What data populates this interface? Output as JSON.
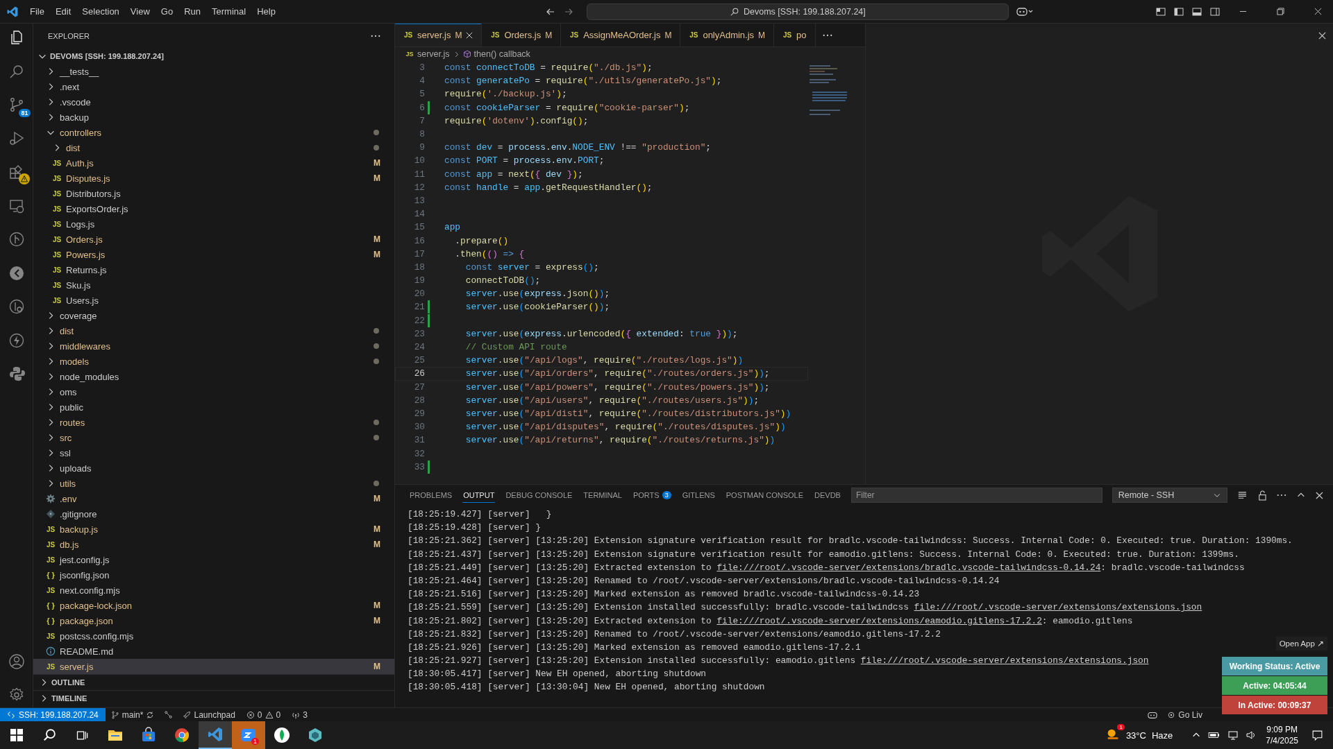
{
  "menu": [
    "File",
    "Edit",
    "Selection",
    "View",
    "Go",
    "Run",
    "Terminal",
    "Help"
  ],
  "command_center": "Devoms [SSH: 199.188.207.24]",
  "activity_bar": {
    "source_control_badge": "81"
  },
  "sidebar": {
    "title": "EXPLORER",
    "root": "DEVOMS [SSH: 199.188.207.24]",
    "root_expanded": true,
    "items": [
      {
        "name": "__tests__",
        "kind": "folder",
        "expanded": false,
        "dot": false,
        "selected": false
      },
      {
        "name": ".next",
        "kind": "folder",
        "expanded": false,
        "dot": false,
        "selected": false
      },
      {
        "name": ".vscode",
        "kind": "folder",
        "expanded": false,
        "dot": false,
        "selected": false
      },
      {
        "name": "backup",
        "kind": "folder",
        "expanded": false,
        "dot": false,
        "selected": false
      },
      {
        "name": "controllers",
        "kind": "folder",
        "expanded": true,
        "dot": true,
        "selected": false,
        "children": [
          {
            "name": "dist",
            "kind": "folder",
            "expanded": false,
            "dot": true,
            "selected": false
          },
          {
            "name": "Auth.js",
            "kind": "js",
            "icon": "JS",
            "badge": "M",
            "dot": false,
            "selected": false
          },
          {
            "name": "Disputes.js",
            "kind": "js",
            "icon": "JS",
            "badge": "M",
            "dot": false,
            "selected": false
          },
          {
            "name": "Distributors.js",
            "kind": "js",
            "icon": "JS",
            "dot": false,
            "selected": false
          },
          {
            "name": "ExportsOrder.js",
            "kind": "js",
            "icon": "JS",
            "dot": false,
            "selected": false
          },
          {
            "name": "Logs.js",
            "kind": "js",
            "icon": "JS",
            "dot": false,
            "selected": false
          },
          {
            "name": "Orders.js",
            "kind": "js",
            "icon": "JS",
            "badge": "M",
            "dot": false,
            "selected": false
          },
          {
            "name": "Powers.js",
            "kind": "js",
            "icon": "JS",
            "badge": "M",
            "dot": false,
            "selected": false
          },
          {
            "name": "Returns.js",
            "kind": "js",
            "icon": "JS",
            "dot": false,
            "selected": false
          },
          {
            "name": "Sku.js",
            "kind": "js",
            "icon": "JS",
            "dot": false,
            "selected": false
          },
          {
            "name": "Users.js",
            "kind": "js",
            "icon": "JS",
            "dot": false,
            "selected": false
          }
        ]
      },
      {
        "name": "coverage",
        "kind": "folder",
        "expanded": false,
        "dot": false,
        "selected": false
      },
      {
        "name": "dist",
        "kind": "folder",
        "expanded": false,
        "dot": true,
        "selected": false
      },
      {
        "name": "middlewares",
        "kind": "folder",
        "expanded": false,
        "dot": true,
        "selected": false
      },
      {
        "name": "models",
        "kind": "folder",
        "expanded": false,
        "dot": true,
        "selected": false
      },
      {
        "name": "node_modules",
        "kind": "folder",
        "expanded": false,
        "dot": false,
        "selected": false
      },
      {
        "name": "oms",
        "kind": "folder",
        "expanded": false,
        "dot": false,
        "selected": false
      },
      {
        "name": "public",
        "kind": "folder",
        "expanded": false,
        "dot": false,
        "selected": false
      },
      {
        "name": "routes",
        "kind": "folder",
        "expanded": false,
        "dot": true,
        "selected": false
      },
      {
        "name": "src",
        "kind": "folder",
        "expanded": false,
        "dot": true,
        "selected": false
      },
      {
        "name": "ssl",
        "kind": "folder",
        "expanded": false,
        "dot": false,
        "selected": false
      },
      {
        "name": "uploads",
        "kind": "folder",
        "expanded": false,
        "dot": false,
        "selected": false
      },
      {
        "name": "utils",
        "kind": "folder",
        "expanded": false,
        "dot": true,
        "selected": false
      },
      {
        "name": ".env",
        "kind": "env",
        "badge": "M",
        "dot": false,
        "selected": false
      },
      {
        "name": ".gitignore",
        "kind": "git",
        "dot": false,
        "selected": false
      },
      {
        "name": "backup.js",
        "kind": "js",
        "icon": "JS",
        "badge": "M",
        "dot": false,
        "selected": false
      },
      {
        "name": "db.js",
        "kind": "js",
        "icon": "JS",
        "badge": "M",
        "dot": false,
        "selected": false
      },
      {
        "name": "jest.config.js",
        "kind": "js",
        "icon": "JS",
        "dot": false,
        "selected": false
      },
      {
        "name": "jsconfig.json",
        "kind": "json",
        "icon": "{ }",
        "dot": false,
        "selected": false
      },
      {
        "name": "next.config.mjs",
        "kind": "js",
        "icon": "JS",
        "dot": false,
        "selected": false
      },
      {
        "name": "package-lock.json",
        "kind": "json",
        "icon": "{ }",
        "badge": "M",
        "dot": false,
        "selected": false
      },
      {
        "name": "package.json",
        "kind": "json",
        "icon": "{ }",
        "badge": "M",
        "dot": false,
        "selected": false
      },
      {
        "name": "postcss.config.mjs",
        "kind": "js",
        "icon": "JS",
        "dot": false,
        "selected": false
      },
      {
        "name": "README.md",
        "kind": "info",
        "dot": false,
        "selected": false
      },
      {
        "name": "server.js",
        "kind": "js",
        "icon": "JS",
        "badge": "M",
        "dot": false,
        "selected": true
      }
    ],
    "sections": [
      {
        "label": "OUTLINE",
        "expanded": false
      },
      {
        "label": "TIMELINE",
        "expanded": false
      }
    ]
  },
  "tabs": [
    {
      "icon": "JS",
      "label": "server.js",
      "badge": "M",
      "selected": true
    },
    {
      "icon": "JS",
      "label": "Orders.js",
      "badge": "M",
      "selected": false
    },
    {
      "icon": "JS",
      "label": "AssignMeAOrder.js",
      "badge": "M",
      "selected": false
    },
    {
      "icon": "JS",
      "label": "onlyAdmin.js",
      "badge": "M",
      "selected": false
    },
    {
      "icon": "JS",
      "label": "po",
      "selected": false
    }
  ],
  "breadcrumb": [
    {
      "icon": "JS",
      "label": "server.js"
    },
    {
      "label": "then() callback"
    }
  ],
  "code": {
    "lines": [
      {
        "n": "3",
        "current": false,
        "changed": false,
        "tokens": [
          {
            "kind": "k",
            "text": "const "
          },
          {
            "kind": "n",
            "text": "connectToDB"
          },
          {
            "kind": "p",
            "text": " = "
          },
          {
            "kind": "f",
            "text": "require"
          },
          {
            "kind": "b1",
            "text": "("
          },
          {
            "kind": "s",
            "text": "\"./db.js\""
          },
          {
            "kind": "b1",
            "text": ")"
          },
          {
            "kind": "p",
            "text": ";"
          }
        ]
      },
      {
        "n": "4",
        "current": false,
        "changed": false,
        "tokens": [
          {
            "kind": "k",
            "text": "const "
          },
          {
            "kind": "n",
            "text": "generatePo"
          },
          {
            "kind": "p",
            "text": " = "
          },
          {
            "kind": "f",
            "text": "require"
          },
          {
            "kind": "b1",
            "text": "("
          },
          {
            "kind": "s",
            "text": "\"./utils/generatePo.js\""
          },
          {
            "kind": "b1",
            "text": ")"
          },
          {
            "kind": "p",
            "text": ";"
          }
        ]
      },
      {
        "n": "5",
        "current": false,
        "changed": false,
        "tokens": [
          {
            "kind": "f",
            "text": "require"
          },
          {
            "kind": "b1",
            "text": "("
          },
          {
            "kind": "s",
            "text": "'./backup.js'"
          },
          {
            "kind": "b1",
            "text": ")"
          },
          {
            "kind": "p",
            "text": ";"
          }
        ]
      },
      {
        "n": "6",
        "current": false,
        "changed": true,
        "tokens": [
          {
            "kind": "k",
            "text": "const "
          },
          {
            "kind": "n",
            "text": "cookieParser"
          },
          {
            "kind": "p",
            "text": " = "
          },
          {
            "kind": "f",
            "text": "require"
          },
          {
            "kind": "b1",
            "text": "("
          },
          {
            "kind": "s",
            "text": "\"cookie-parser\""
          },
          {
            "kind": "b1",
            "text": ")"
          },
          {
            "kind": "p",
            "text": ";"
          }
        ]
      },
      {
        "n": "7",
        "current": false,
        "changed": false,
        "tokens": [
          {
            "kind": "f",
            "text": "require"
          },
          {
            "kind": "b1",
            "text": "("
          },
          {
            "kind": "s",
            "text": "'dotenv'"
          },
          {
            "kind": "b1",
            "text": ")"
          },
          {
            "kind": "p",
            "text": "."
          },
          {
            "kind": "f",
            "text": "config"
          },
          {
            "kind": "b1",
            "text": "()"
          },
          {
            "kind": "p",
            "text": ";"
          }
        ]
      },
      {
        "n": "8",
        "current": false,
        "changed": false
      },
      {
        "n": "9",
        "current": false,
        "changed": false,
        "tokens": [
          {
            "kind": "k",
            "text": "const "
          },
          {
            "kind": "n",
            "text": "dev"
          },
          {
            "kind": "p",
            "text": " = "
          },
          {
            "kind": "v",
            "text": "process"
          },
          {
            "kind": "p",
            "text": "."
          },
          {
            "kind": "v",
            "text": "env"
          },
          {
            "kind": "p",
            "text": "."
          },
          {
            "kind": "n",
            "text": "NODE_ENV"
          },
          {
            "kind": "p",
            "text": " !== "
          },
          {
            "kind": "s",
            "text": "\"production\""
          },
          {
            "kind": "p",
            "text": ";"
          }
        ]
      },
      {
        "n": "10",
        "current": false,
        "changed": false,
        "tokens": [
          {
            "kind": "k",
            "text": "const "
          },
          {
            "kind": "n",
            "text": "PORT"
          },
          {
            "kind": "p",
            "text": " = "
          },
          {
            "kind": "v",
            "text": "process"
          },
          {
            "kind": "p",
            "text": "."
          },
          {
            "kind": "v",
            "text": "env"
          },
          {
            "kind": "p",
            "text": "."
          },
          {
            "kind": "n",
            "text": "PORT"
          },
          {
            "kind": "p",
            "text": ";"
          }
        ]
      },
      {
        "n": "11",
        "current": false,
        "changed": false,
        "tokens": [
          {
            "kind": "k",
            "text": "const "
          },
          {
            "kind": "n",
            "text": "app"
          },
          {
            "kind": "p",
            "text": " = "
          },
          {
            "kind": "f",
            "text": "next"
          },
          {
            "kind": "b1",
            "text": "("
          },
          {
            "kind": "b2",
            "text": "{"
          },
          {
            "kind": "v",
            "text": " dev "
          },
          {
            "kind": "b2",
            "text": "}"
          },
          {
            "kind": "b1",
            "text": ")"
          },
          {
            "kind": "p",
            "text": ";"
          }
        ]
      },
      {
        "n": "12",
        "current": false,
        "changed": false,
        "tokens": [
          {
            "kind": "k",
            "text": "const "
          },
          {
            "kind": "n",
            "text": "handle"
          },
          {
            "kind": "p",
            "text": " = "
          },
          {
            "kind": "n",
            "text": "app"
          },
          {
            "kind": "p",
            "text": "."
          },
          {
            "kind": "f",
            "text": "getRequestHandler"
          },
          {
            "kind": "b1",
            "text": "()"
          },
          {
            "kind": "p",
            "text": ";"
          }
        ]
      },
      {
        "n": "13",
        "current": false,
        "changed": false
      },
      {
        "n": "14",
        "current": false,
        "changed": false
      },
      {
        "n": "15",
        "current": false,
        "changed": false,
        "tokens": [
          {
            "kind": "n",
            "text": "app"
          }
        ]
      },
      {
        "n": "16",
        "current": false,
        "changed": false,
        "tokens": [
          {
            "kind": "p",
            "text": "  ."
          },
          {
            "kind": "f",
            "text": "prepare"
          },
          {
            "kind": "b1",
            "text": "()"
          }
        ]
      },
      {
        "n": "17",
        "current": false,
        "changed": false,
        "tokens": [
          {
            "kind": "p",
            "text": "  ."
          },
          {
            "kind": "f",
            "text": "then"
          },
          {
            "kind": "b1",
            "text": "("
          },
          {
            "kind": "b2",
            "text": "() "
          },
          {
            "kind": "k",
            "text": "=> "
          },
          {
            "kind": "b2",
            "text": "{"
          }
        ]
      },
      {
        "n": "18",
        "current": false,
        "changed": false,
        "tokens": [
          {
            "kind": "k",
            "text": "    const "
          },
          {
            "kind": "n",
            "text": "server"
          },
          {
            "kind": "p",
            "text": " = "
          },
          {
            "kind": "f",
            "text": "express"
          },
          {
            "kind": "b3",
            "text": "()"
          },
          {
            "kind": "p",
            "text": ";"
          }
        ]
      },
      {
        "n": "19",
        "current": false,
        "changed": false,
        "tokens": [
          {
            "kind": "f",
            "text": "    connectToDB"
          },
          {
            "kind": "b3",
            "text": "()"
          },
          {
            "kind": "p",
            "text": ";"
          }
        ]
      },
      {
        "n": "20",
        "current": false,
        "changed": false,
        "tokens": [
          {
            "kind": "n",
            "text": "    server"
          },
          {
            "kind": "p",
            "text": "."
          },
          {
            "kind": "f",
            "text": "use"
          },
          {
            "kind": "b3",
            "text": "("
          },
          {
            "kind": "v",
            "text": "express"
          },
          {
            "kind": "p",
            "text": "."
          },
          {
            "kind": "f",
            "text": "json"
          },
          {
            "kind": "b1",
            "text": "()"
          },
          {
            "kind": "b3",
            "text": ")"
          },
          {
            "kind": "p",
            "text": ";"
          }
        ]
      },
      {
        "n": "21",
        "current": false,
        "changed": true,
        "tokens": [
          {
            "kind": "n",
            "text": "    server"
          },
          {
            "kind": "p",
            "text": "."
          },
          {
            "kind": "f",
            "text": "use"
          },
          {
            "kind": "b3",
            "text": "("
          },
          {
            "kind": "f",
            "text": "cookieParser"
          },
          {
            "kind": "b1",
            "text": "()"
          },
          {
            "kind": "b3",
            "text": ")"
          },
          {
            "kind": "p",
            "text": ";"
          }
        ]
      },
      {
        "n": "22",
        "current": false,
        "changed": true
      },
      {
        "n": "23",
        "current": false,
        "changed": false,
        "tokens": [
          {
            "kind": "n",
            "text": "    server"
          },
          {
            "kind": "p",
            "text": "."
          },
          {
            "kind": "f",
            "text": "use"
          },
          {
            "kind": "b3",
            "text": "("
          },
          {
            "kind": "v",
            "text": "express"
          },
          {
            "kind": "p",
            "text": "."
          },
          {
            "kind": "f",
            "text": "urlencoded"
          },
          {
            "kind": "b1",
            "text": "("
          },
          {
            "kind": "b2",
            "text": "{"
          },
          {
            "kind": "v",
            "text": " extended"
          },
          {
            "kind": "p",
            "text": ": "
          },
          {
            "kind": "k",
            "text": "true "
          },
          {
            "kind": "b2",
            "text": "}"
          },
          {
            "kind": "b1",
            "text": ")"
          },
          {
            "kind": "b3",
            "text": ")"
          },
          {
            "kind": "p",
            "text": ";"
          }
        ]
      },
      {
        "n": "24",
        "current": false,
        "changed": false,
        "tokens": [
          {
            "kind": "c",
            "text": "    // Custom API route"
          }
        ]
      },
      {
        "n": "25",
        "current": false,
        "changed": false,
        "tokens": [
          {
            "kind": "n",
            "text": "    server"
          },
          {
            "kind": "p",
            "text": "."
          },
          {
            "kind": "f",
            "text": "use"
          },
          {
            "kind": "b3",
            "text": "("
          },
          {
            "kind": "s",
            "text": "\"/api/logs\""
          },
          {
            "kind": "p",
            "text": ", "
          },
          {
            "kind": "f",
            "text": "require"
          },
          {
            "kind": "b1",
            "text": "("
          },
          {
            "kind": "s",
            "text": "\"./routes/logs.js\""
          },
          {
            "kind": "b1",
            "text": ")"
          },
          {
            "kind": "b3",
            "text": ")"
          }
        ]
      },
      {
        "n": "26",
        "current": true,
        "changed": false,
        "tokens": [
          {
            "kind": "n",
            "text": "    server"
          },
          {
            "kind": "p",
            "text": "."
          },
          {
            "kind": "f",
            "text": "use"
          },
          {
            "kind": "b3",
            "text": "("
          },
          {
            "kind": "s",
            "text": "\"/api/orders\""
          },
          {
            "kind": "p",
            "text": ", "
          },
          {
            "kind": "f",
            "text": "require"
          },
          {
            "kind": "b1",
            "text": "("
          },
          {
            "kind": "s",
            "text": "\"./routes/orders.js\""
          },
          {
            "kind": "b1",
            "text": ")"
          },
          {
            "kind": "b3",
            "text": ")"
          },
          {
            "kind": "p",
            "text": ";"
          }
        ]
      },
      {
        "n": "27",
        "current": false,
        "changed": false,
        "tokens": [
          {
            "kind": "n",
            "text": "    server"
          },
          {
            "kind": "p",
            "text": "."
          },
          {
            "kind": "f",
            "text": "use"
          },
          {
            "kind": "b3",
            "text": "("
          },
          {
            "kind": "s",
            "text": "\"/api/powers\""
          },
          {
            "kind": "p",
            "text": ", "
          },
          {
            "kind": "f",
            "text": "require"
          },
          {
            "kind": "b1",
            "text": "("
          },
          {
            "kind": "s",
            "text": "\"./routes/powers.js\""
          },
          {
            "kind": "b1",
            "text": ")"
          },
          {
            "kind": "b3",
            "text": ")"
          },
          {
            "kind": "p",
            "text": ";"
          }
        ]
      },
      {
        "n": "28",
        "current": false,
        "changed": false,
        "tokens": [
          {
            "kind": "n",
            "text": "    server"
          },
          {
            "kind": "p",
            "text": "."
          },
          {
            "kind": "f",
            "text": "use"
          },
          {
            "kind": "b3",
            "text": "("
          },
          {
            "kind": "s",
            "text": "\"/api/users\""
          },
          {
            "kind": "p",
            "text": ", "
          },
          {
            "kind": "f",
            "text": "require"
          },
          {
            "kind": "b1",
            "text": "("
          },
          {
            "kind": "s",
            "text": "\"./routes/users.js\""
          },
          {
            "kind": "b1",
            "text": ")"
          },
          {
            "kind": "b3",
            "text": ")"
          },
          {
            "kind": "p",
            "text": ";"
          }
        ]
      },
      {
        "n": "29",
        "current": false,
        "changed": false,
        "tokens": [
          {
            "kind": "n",
            "text": "    server"
          },
          {
            "kind": "p",
            "text": "."
          },
          {
            "kind": "f",
            "text": "use"
          },
          {
            "kind": "b3",
            "text": "("
          },
          {
            "kind": "s",
            "text": "\"/api/disti\""
          },
          {
            "kind": "p",
            "text": ", "
          },
          {
            "kind": "f",
            "text": "require"
          },
          {
            "kind": "b1",
            "text": "("
          },
          {
            "kind": "s",
            "text": "\"./routes/distributors.js\""
          },
          {
            "kind": "b1",
            "text": ")"
          },
          {
            "kind": "b3",
            "text": ")"
          }
        ]
      },
      {
        "n": "30",
        "current": false,
        "changed": false,
        "tokens": [
          {
            "kind": "n",
            "text": "    server"
          },
          {
            "kind": "p",
            "text": "."
          },
          {
            "kind": "f",
            "text": "use"
          },
          {
            "kind": "b3",
            "text": "("
          },
          {
            "kind": "s",
            "text": "\"/api/disputes\""
          },
          {
            "kind": "p",
            "text": ", "
          },
          {
            "kind": "f",
            "text": "require"
          },
          {
            "kind": "b1",
            "text": "("
          },
          {
            "kind": "s",
            "text": "\"./routes/disputes.js\""
          },
          {
            "kind": "b1",
            "text": ")"
          },
          {
            "kind": "b3",
            "text": ")"
          }
        ]
      },
      {
        "n": "31",
        "current": false,
        "changed": false,
        "tokens": [
          {
            "kind": "n",
            "text": "    server"
          },
          {
            "kind": "p",
            "text": "."
          },
          {
            "kind": "f",
            "text": "use"
          },
          {
            "kind": "b3",
            "text": "("
          },
          {
            "kind": "s",
            "text": "\"/api/returns\""
          },
          {
            "kind": "p",
            "text": ", "
          },
          {
            "kind": "f",
            "text": "require"
          },
          {
            "kind": "b1",
            "text": "("
          },
          {
            "kind": "s",
            "text": "\"./routes/returns.js\""
          },
          {
            "kind": "b1",
            "text": ")"
          },
          {
            "kind": "b3",
            "text": ")"
          }
        ]
      },
      {
        "n": "32",
        "current": false,
        "changed": false
      },
      {
        "n": "33",
        "current": false,
        "changed": true
      }
    ]
  },
  "panel": {
    "tabs": [
      {
        "label": "PROBLEMS",
        "selected": false
      },
      {
        "label": "OUTPUT",
        "selected": true
      },
      {
        "label": "DEBUG CONSOLE",
        "selected": false
      },
      {
        "label": "TERMINAL",
        "selected": false
      },
      {
        "label": "PORTS",
        "count": "3",
        "selected": false
      },
      {
        "label": "GITLENS",
        "selected": false
      },
      {
        "label": "POSTMAN CONSOLE",
        "selected": false
      },
      {
        "label": "DEVDB",
        "selected": false
      }
    ],
    "filter_placeholder": "Filter",
    "channel": "Remote - SSH",
    "lines": [
      [
        {
          "kind": "text",
          "text": "[18:25:19.427] [server]   }"
        }
      ],
      [
        {
          "kind": "text",
          "text": "[18:25:19.428] [server] }"
        }
      ],
      [
        {
          "kind": "text",
          "text": "[18:25:21.362] [server] [13:25:20] Extension signature verification result for bradlc.vscode-tailwindcss: Success. Internal Code: 0. Executed: true. Duration: 1390ms."
        }
      ],
      [
        {
          "kind": "text",
          "text": "[18:25:21.437] [server] [13:25:20] Extension signature verification result for eamodio.gitlens: Success. Internal Code: 0. Executed: true. Duration: 1399ms."
        }
      ],
      [
        {
          "kind": "text",
          "text": "[18:25:21.449] [server] [13:25:20] Extracted extension to "
        },
        {
          "kind": "link",
          "text": "file:///root/.vscode-server/extensions/bradlc.vscode-tailwindcss-0.14.24"
        },
        {
          "kind": "text",
          "text": ": bradlc.vscode-tailwindcss"
        }
      ],
      [
        {
          "kind": "text",
          "text": "[18:25:21.464] [server] [13:25:20] Renamed to /root/.vscode-server/extensions/bradlc.vscode-tailwindcss-0.14.24"
        }
      ],
      [
        {
          "kind": "text",
          "text": "[18:25:21.516] [server] [13:25:20] Marked extension as removed bradlc.vscode-tailwindcss-0.14.23"
        }
      ],
      [
        {
          "kind": "text",
          "text": "[18:25:21.559] [server] [13:25:20] Extension installed successfully: bradlc.vscode-tailwindcss "
        },
        {
          "kind": "link",
          "text": "file:///root/.vscode-server/extensions/extensions.json"
        }
      ],
      [
        {
          "kind": "text",
          "text": "[18:25:21.802] [server] [13:25:20] Extracted extension to "
        },
        {
          "kind": "link",
          "text": "file:///root/.vscode-server/extensions/eamodio.gitlens-17.2.2"
        },
        {
          "kind": "text",
          "text": ": eamodio.gitlens"
        }
      ],
      [
        {
          "kind": "text",
          "text": "[18:25:21.832] [server] [13:25:20] Renamed to /root/.vscode-server/extensions/eamodio.gitlens-17.2.2"
        }
      ],
      [
        {
          "kind": "text",
          "text": "[18:25:21.926] [server] [13:25:20] Marked extension as removed eamodio.gitlens-17.2.1"
        }
      ],
      [
        {
          "kind": "text",
          "text": "[18:25:21.927] [server] [13:25:20] Extension installed successfully: eamodio.gitlens "
        },
        {
          "kind": "link",
          "text": "file:///root/.vscode-server/extensions/extensions.json"
        }
      ],
      [
        {
          "kind": "text",
          "text": "[18:30:05.417] [server] New EH opened, aborting shutdown"
        }
      ],
      [
        {
          "kind": "text",
          "text": "[18:30:05.418] [server] [13:30:04] New EH opened, aborting shutdown"
        }
      ]
    ]
  },
  "overlay": {
    "open_app": "Open App ↗",
    "items": [
      {
        "text": "Working Status: Active",
        "color": "#4a9aa3"
      },
      {
        "text": "Active: 04:05:44",
        "color": "#3c9f55"
      },
      {
        "text": "In Active: 00:09:37",
        "color": "#c0433b"
      }
    ]
  },
  "status_bar": {
    "remote": "SSH: 199.188.207.24",
    "branch": "main*",
    "launchpad": "Launchpad",
    "errors": "0",
    "warnings": "0",
    "ports": "3",
    "go_live": "Go Liv"
  },
  "taskbar": {
    "apps": [
      {
        "kind": "folder",
        "selected": false,
        "attention": false
      },
      {
        "kind": "store",
        "selected": false,
        "attention": false
      },
      {
        "kind": "chrome",
        "selected": false,
        "attention": false
      },
      {
        "kind": "editor",
        "selected": true,
        "attention": false
      },
      {
        "kind": "chat",
        "badge": "1",
        "selected": false,
        "attention": true
      },
      {
        "kind": "leaf",
        "selected": false,
        "attention": false
      },
      {
        "kind": "cube",
        "selected": false,
        "attention": false
      }
    ],
    "weather": {
      "badge": "1",
      "temp": "33°C",
      "text": "Haze"
    },
    "time": "9:09 PM",
    "date": "7/4/2025"
  }
}
